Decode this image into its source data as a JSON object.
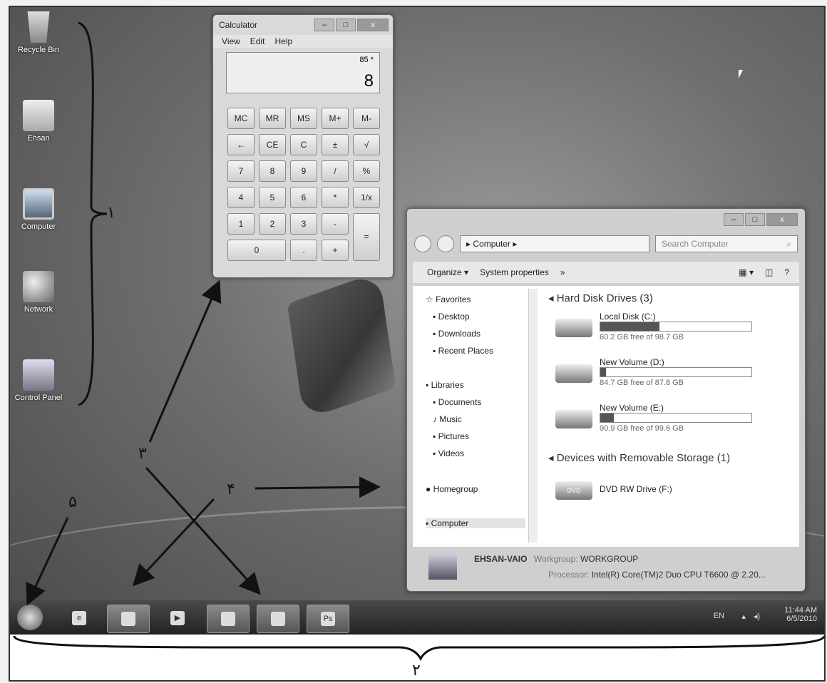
{
  "desktop": {
    "icons": [
      {
        "label": "Recycle Bin"
      },
      {
        "label": "Ehsan"
      },
      {
        "label": "Computer"
      },
      {
        "label": "Network"
      },
      {
        "label": "Control Panel"
      }
    ]
  },
  "calculator": {
    "title": "Calculator",
    "menu": [
      "View",
      "Edit",
      "Help"
    ],
    "memo": "85 *",
    "value": "8",
    "keys": [
      "MC",
      "MR",
      "MS",
      "M+",
      "M-",
      "←",
      "CE",
      "C",
      "±",
      "√",
      "7",
      "8",
      "9",
      "/",
      "%",
      "4",
      "5",
      "6",
      "*",
      "1/x",
      "1",
      "2",
      "3",
      "-",
      "=",
      "0",
      ".",
      "+"
    ]
  },
  "explorer": {
    "path": "Computer",
    "search_placeholder": "Search Computer",
    "toolbar": {
      "organize": "Organize ▾",
      "system_properties": "System properties",
      "more": "»"
    },
    "nav": {
      "favorites": "Favorites",
      "desktop": "Desktop",
      "downloads": "Downloads",
      "recent": "Recent Places",
      "libraries": "Libraries",
      "documents": "Documents",
      "music": "Music",
      "pictures": "Pictures",
      "videos": "Videos",
      "homegroup": "Homegroup",
      "computer": "Computer"
    },
    "hard_disk_header": "Hard Disk Drives (3)",
    "drives": [
      {
        "name": "Local Disk (C:)",
        "free": "60.2 GB free of 98.7 GB",
        "used_fraction": 0.39
      },
      {
        "name": "New Volume (D:)",
        "free": "84.7 GB free of 87.8 GB",
        "used_fraction": 0.04
      },
      {
        "name": "New Volume (E:)",
        "free": "90.9 GB free of 99.6 GB",
        "used_fraction": 0.09
      }
    ],
    "removable_header": "Devices with Removable Storage (1)",
    "dvd": {
      "name": "DVD RW Drive (F:)",
      "badge": "DVD"
    },
    "details": {
      "name": "EHSAN-VAIO",
      "workgroup_label": "Workgroup:",
      "workgroup": "WORKGROUP",
      "processor_label": "Processor:",
      "processor": "Intel(R) Core(TM)2 Duo CPU    T6600  @ 2.20..."
    }
  },
  "taskbar": {
    "language": "EN",
    "time": "11:44 AM",
    "date": "6/5/2010",
    "ps_label": "Ps"
  },
  "annotations": {
    "n1": "۱",
    "n2": "۲",
    "n3": "۳",
    "n4": "۴",
    "n5": "۵"
  }
}
